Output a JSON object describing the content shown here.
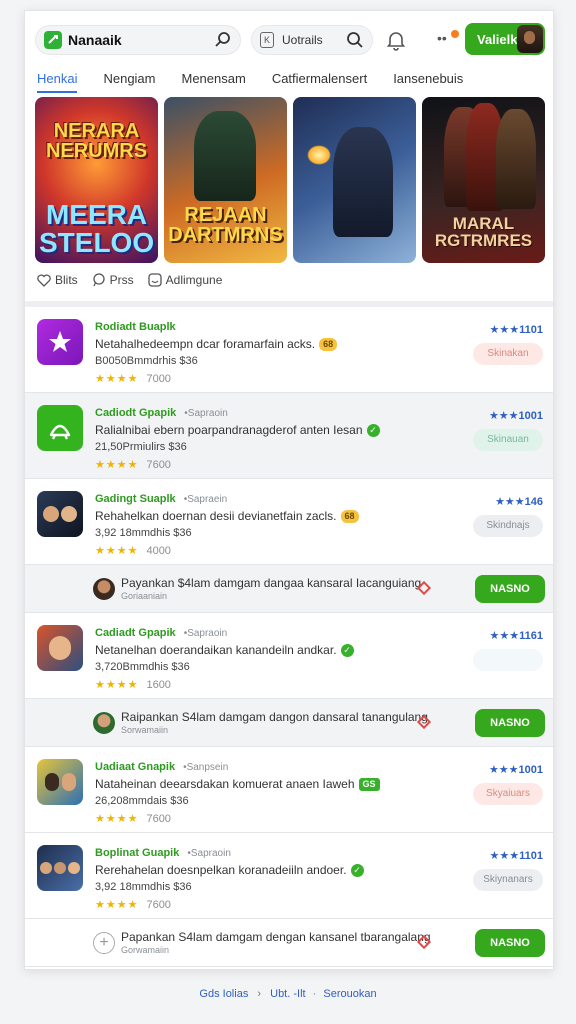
{
  "header": {
    "app_name": "Nanaaik",
    "search_label": "Uotrails",
    "search_key": "K",
    "account_label": "Valielk",
    "dots": "••"
  },
  "tabs": [
    {
      "label": "Henkai",
      "active": true
    },
    {
      "label": "Nengiam",
      "active": false
    },
    {
      "label": "Menensam",
      "active": false
    },
    {
      "label": "Catfiermalensert",
      "active": false
    },
    {
      "label": "Iansenebuis",
      "active": false
    }
  ],
  "banners": [
    {
      "line1": "NERARA NERUMRS",
      "line2": "MEERA STELOO"
    },
    {
      "line1": "REJAAN DARTMRNS"
    },
    {},
    {
      "line1": "MARAL RGTRMRES"
    }
  ],
  "actions": {
    "likes": "Blits",
    "press": "Prss",
    "more": "Adlimgune"
  },
  "apps": [
    {
      "title": "Rodiadt Buaplk",
      "subtitle": "",
      "desc": "Netahalhedeempn dcar foramarfain acks.",
      "badge": "68",
      "badge_style": "yellow",
      "meta": "B0050Bmmdrhis $36",
      "stars": "★★★★",
      "count": "7000",
      "rating": "★★★1101",
      "button": "Skinakan",
      "btn_style": "pink",
      "icon": "star",
      "shade": false
    },
    {
      "title": "Cadiodt Gpapik",
      "subtitle": "•Sapraoin",
      "desc": "Ralialnibai ebern poarpandranagderof anten Iesan",
      "badge": "✓",
      "badge_style": "green",
      "meta": "21,50Prmiulirs $36",
      "stars": "★★★★",
      "count": "7600",
      "rating": "★★★1001",
      "button": "Skinauan",
      "btn_style": "mint",
      "icon": "bowl",
      "shade": true
    },
    {
      "title": "Gadingt Suaplk",
      "subtitle": "•Sapraein",
      "desc": "Rehahelkan doernan desii devianetfain zacls.",
      "badge": "68",
      "badge_style": "yellow",
      "meta": "3,92 18mmdhis $36",
      "stars": "★★★★",
      "count": "4000",
      "rating": "★★★146",
      "button": "Skindnajs",
      "btn_style": "gray",
      "icon": "people",
      "shade": false
    },
    {
      "title": "Cadiadt Gpapik",
      "subtitle": "•Sapraoin",
      "desc": "Netanelhan doerandaikan kanandeiln andkar.",
      "badge": "✓",
      "badge_style": "green",
      "meta": "3,720Bmmdhis $36",
      "stars": "★★★★",
      "count": "1600",
      "rating": "★★★1161",
      "button": "",
      "btn_style": "faint",
      "icon": "face",
      "shade": false
    },
    {
      "title": "Uadiaat Gnapik",
      "subtitle": "•Sanpsein",
      "desc": "Nataheinan deearsdakan komuerat anaen Iaweh",
      "badge": "GS",
      "badge_style": "green-box",
      "meta": "26,208mmdais $36",
      "stars": "★★★★",
      "count": "7600",
      "rating": "★★★1001",
      "button": "Skyaiuars",
      "btn_style": "pink",
      "icon": "guys",
      "shade": false
    },
    {
      "title": "Boplinat Guapik",
      "subtitle": "•Sapraoin",
      "desc": "Rerehahelan doesnpelkan koranadeiiln andoer.",
      "badge": "✓",
      "badge_style": "green",
      "meta": "3,92 18mmdhis $36",
      "stars": "★★★★",
      "count": "7600",
      "rating": "★★★1101",
      "button": "Skiynanars",
      "btn_style": "gray",
      "icon": "crowd",
      "shade": false
    }
  ],
  "promos": [
    {
      "text": "Payankan $4lam damgam dangaa kansaral Iacanguiang",
      "sub": "Goriaaniain",
      "button": "NASNO",
      "avatar": "person1"
    },
    {
      "text": "Raipankan S4lam damgam dangon dansaral tanangulang",
      "sub": "Sorwamaiin",
      "button": "NASNO",
      "avatar": "person2"
    },
    {
      "text": "Papankan S4lam damgam dengan kansanel tbarangalang",
      "sub": "Gorwamaiin",
      "button": "NASNO",
      "avatar": "plus"
    }
  ],
  "footer": {
    "left": "Gds Iolias",
    "mid": "Ubt. -Ilt",
    "right": "Serouokan",
    "sep": "›"
  }
}
